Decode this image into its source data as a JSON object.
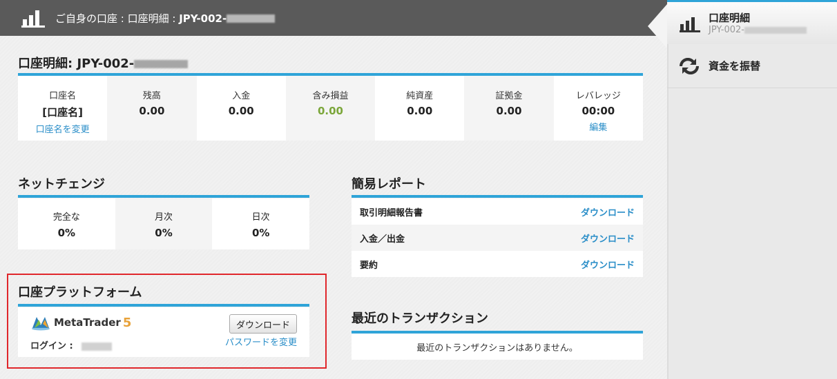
{
  "header": {
    "title_prefix": "ご自身の口座 : 口座明細 : ",
    "account_id": "JPY-002-"
  },
  "account_detail": {
    "title": "口座明細: JPY-002-",
    "cells": [
      {
        "label": "口座名",
        "value": "[口座名]",
        "link": "口座名を変更"
      },
      {
        "label": "残高",
        "value": "0.00"
      },
      {
        "label": "入金",
        "value": "0.00"
      },
      {
        "label": "含み損益",
        "value": "0.00"
      },
      {
        "label": "純資産",
        "value": "0.00"
      },
      {
        "label": "証拠金",
        "value": "0.00"
      },
      {
        "label": "レバレッジ",
        "value": "00:00",
        "link": "編集"
      }
    ]
  },
  "net_change": {
    "title": "ネットチェンジ",
    "cells": [
      {
        "label": "完全な",
        "value": "0%"
      },
      {
        "label": "月次",
        "value": "0%"
      },
      {
        "label": "日次",
        "value": "0%"
      }
    ]
  },
  "simple_report": {
    "title": "簡易レポート",
    "rows": [
      {
        "label": "取引明細報告書",
        "action": "ダウンロード"
      },
      {
        "label": "入金／出金",
        "action": "ダウンロード"
      },
      {
        "label": "要約",
        "action": "ダウンロード"
      }
    ]
  },
  "platform": {
    "title": "口座プラットフォーム",
    "logo_name": "MetaTrader",
    "logo_version": "5",
    "login_label": "ログイン :",
    "download_button": "ダウンロード",
    "password_link": "パスワードを変更"
  },
  "recent_transactions": {
    "title": "最近のトランザクション",
    "empty_text": "最近のトランザクションはありません。"
  },
  "sidebar": {
    "active_title": "口座明細",
    "active_subtitle": "JPY-002-",
    "transfer_label": "資金を振替"
  },
  "colors": {
    "accent_blue": "#2fa4d8",
    "link_blue": "#2a8ec8",
    "positive_green": "#7ba63a",
    "highlight_red": "#e0262b",
    "header_gray": "#5a5a5a"
  }
}
